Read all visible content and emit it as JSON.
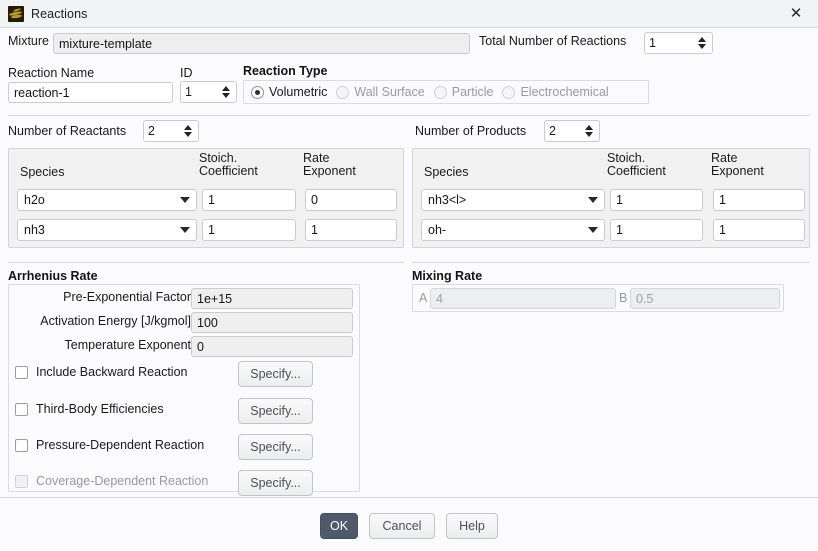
{
  "window": {
    "title": "Reactions",
    "icon": "reactions-icon",
    "close_label": "✕"
  },
  "mixture_row": {
    "mixture_label": "Mixture",
    "mixture_value": "mixture-template",
    "total_label": "Total Number of Reactions",
    "total_value": "1"
  },
  "reaction_row": {
    "name_label": "Reaction Name",
    "name_value": "reaction-1",
    "id_label": "ID",
    "id_value": "1",
    "type_label": "Reaction Type",
    "types": [
      {
        "label": "Volumetric",
        "selected": true,
        "disabled": false
      },
      {
        "label": "Wall Surface",
        "selected": false,
        "disabled": true
      },
      {
        "label": "Particle",
        "selected": false,
        "disabled": true
      },
      {
        "label": "Electrochemical",
        "selected": false,
        "disabled": true
      }
    ]
  },
  "reactants": {
    "count_label": "Number of Reactants",
    "count_value": "2",
    "headers": {
      "species": "Species",
      "stoich": "Stoich.\nCoefficient",
      "stoich_l1": "Stoich.",
      "stoich_l2": "Coefficient",
      "rate_l1": "Rate",
      "rate_l2": "Exponent"
    },
    "rows": [
      {
        "species": "h2o",
        "stoich": "1",
        "rate": "0"
      },
      {
        "species": "nh3",
        "stoich": "1",
        "rate": "1"
      }
    ]
  },
  "products": {
    "count_label": "Number of Products",
    "count_value": "2",
    "headers": {
      "species": "Species",
      "stoich_l1": "Stoich.",
      "stoich_l2": "Coefficient",
      "rate_l1": "Rate",
      "rate_l2": "Exponent"
    },
    "rows": [
      {
        "species": "nh3<l>",
        "stoich": "1",
        "rate": "1"
      },
      {
        "species": "oh-",
        "stoich": "1",
        "rate": "1"
      }
    ]
  },
  "arrhenius": {
    "title": "Arrhenius Rate",
    "fields": [
      {
        "label": "Pre-Exponential Factor",
        "value": "1e+15"
      },
      {
        "label": "Activation Energy  [J/kgmol]",
        "value": "100"
      },
      {
        "label": "Temperature Exponent",
        "value": "0"
      }
    ],
    "options": [
      {
        "label": "Include Backward Reaction",
        "checked": false,
        "disabled": false,
        "button": "Specify..."
      },
      {
        "label": "Third-Body Efficiencies",
        "checked": false,
        "disabled": false,
        "button": "Specify..."
      },
      {
        "label": "Pressure-Dependent Reaction",
        "checked": false,
        "disabled": false,
        "button": "Specify..."
      },
      {
        "label": "Coverage-Dependent Reaction",
        "checked": false,
        "disabled": true,
        "button": "Specify..."
      }
    ]
  },
  "mixing": {
    "title": "Mixing Rate",
    "a_label": "A",
    "a_value": "4",
    "b_label": "B",
    "b_value": "0.5"
  },
  "footer": {
    "ok": "OK",
    "cancel": "Cancel",
    "help": "Help"
  },
  "colors": {
    "ok_button": "#4e5a6b",
    "window_bg": "#fbfbfd",
    "titlebar_bg": "#f2f3f5",
    "field_bg": "#efeff0",
    "panel_bg": "#f1f1f2"
  }
}
